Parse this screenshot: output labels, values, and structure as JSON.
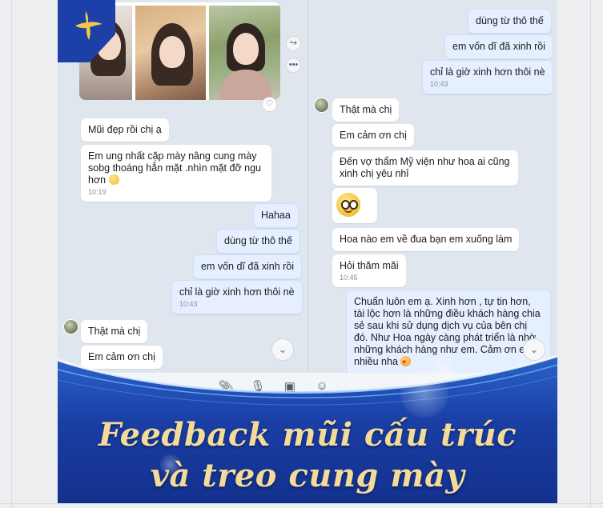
{
  "left_chat": {
    "messages": [
      {
        "text": "Mũi đẹp rồi chị ạ",
        "dir": "in"
      },
      {
        "text": "Em ung nhất cặp mày nâng cung mày sobg thoáng hẳn mặt .nhìn mặt đỡ ngu hơn",
        "dir": "in",
        "time": "10:19"
      },
      {
        "text": "Hahaa",
        "dir": "out"
      },
      {
        "text": "dùng từ thô thế",
        "dir": "out"
      },
      {
        "text": "em vốn dĩ đã xinh rồi",
        "dir": "out"
      },
      {
        "text": "chỉ là giờ xinh hơn thôi nè",
        "dir": "out",
        "time": "10:43"
      },
      {
        "text": "Thật mà chị",
        "dir": "in"
      },
      {
        "text": "Em cảm ơn chị",
        "dir": "in"
      }
    ]
  },
  "right_chat": {
    "messages": [
      {
        "text": "dùng từ thô thế",
        "dir": "out"
      },
      {
        "text": "em vốn dĩ đã xinh rồi",
        "dir": "out"
      },
      {
        "text": "chỉ là giờ xinh hơn thôi nè",
        "dir": "out",
        "time": "10:43"
      },
      {
        "text": "Thật mà chị",
        "dir": "in"
      },
      {
        "text": "Em cảm ơn chị",
        "dir": "in"
      },
      {
        "text": "Đến vợ thẩm Mỹ viện như hoa ai cũng xinh chị yêu nhỉ",
        "dir": "in"
      },
      {
        "text": "Hoa nào em về đua bạn em xuống làm",
        "dir": "in"
      },
      {
        "text": "Hỏi thăm mãi",
        "dir": "in",
        "time": "10:45"
      },
      {
        "text": "Chuẩn luôn em ạ. Xinh hơn , tự tin hơn, tài lộc hơn là những điều khách hàng chia sẻ sau khi sử dụng dịch vụ của bên chị đó. Như Hoa ngày càng phát triển là nhờ những khách hàng như em. Cảm ơn em nhiều nha",
        "dir": "out"
      }
    ]
  },
  "banner": {
    "line1": "Feedback mũi cấu trúc",
    "line2": "và treo cung mày"
  },
  "icons": {
    "share": "share-icon",
    "more": "more-icon",
    "heart": "heart-icon",
    "scroll_down": "chevron-down-icon",
    "attach": "paperclip-icon",
    "mic": "microphone-icon",
    "image": "image-icon",
    "sticker": "sticker-icon"
  },
  "colors": {
    "outgoing_bubble": "#e5efff",
    "incoming_bubble": "#ffffff",
    "banner_blue": "#1d3fa8",
    "headline_gold": "#f3dc9a"
  }
}
